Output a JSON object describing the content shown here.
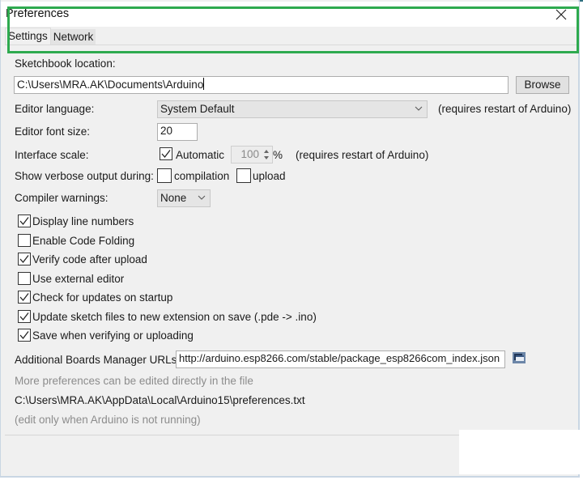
{
  "window": {
    "title": "Preferences",
    "close_icon": "close-icon"
  },
  "tabs": [
    {
      "label": "Settings",
      "active": true
    },
    {
      "label": "Network",
      "active": false
    }
  ],
  "sketchbook": {
    "label": "Sketchbook location:",
    "value": "C:\\Users\\MRA.AK\\Documents\\Arduino",
    "browse_label": "Browse",
    "highlight_color": "#2eaa4f"
  },
  "editor_language": {
    "label": "Editor language:",
    "selected": "System Default",
    "note": "(requires restart of Arduino)"
  },
  "editor_font_size": {
    "label": "Editor font size:",
    "value": "20"
  },
  "interface_scale": {
    "label": "Interface scale:",
    "automatic_label": "Automatic",
    "automatic_checked": true,
    "value": "100",
    "unit": "%",
    "note": "(requires restart of Arduino)"
  },
  "verbose": {
    "label": "Show verbose output during:",
    "compilation_label": "compilation",
    "compilation_checked": false,
    "upload_label": "upload",
    "upload_checked": false
  },
  "compiler_warnings": {
    "label": "Compiler warnings:",
    "selected": "None"
  },
  "options": [
    {
      "label": "Display line numbers",
      "checked": true
    },
    {
      "label": "Enable Code Folding",
      "checked": false
    },
    {
      "label": "Verify code after upload",
      "checked": true
    },
    {
      "label": "Use external editor",
      "checked": false
    },
    {
      "label": "Check for updates on startup",
      "checked": true
    },
    {
      "label": "Update sketch files to new extension on save (.pde -> .ino)",
      "checked": true
    },
    {
      "label": "Save when verifying or uploading",
      "checked": true
    }
  ],
  "boards_manager": {
    "label": "Additional Boards Manager URLs:",
    "value": "http://arduino.esp8266.com/stable/package_esp8266com_index.json",
    "icon": "window-list-icon"
  },
  "footer": {
    "more_prefs": "More preferences can be edited directly in the file",
    "path": "C:\\Users\\MRA.AK\\AppData\\Local\\Arduino15\\preferences.txt",
    "edit_note": "(edit only when Arduino is not running)"
  }
}
